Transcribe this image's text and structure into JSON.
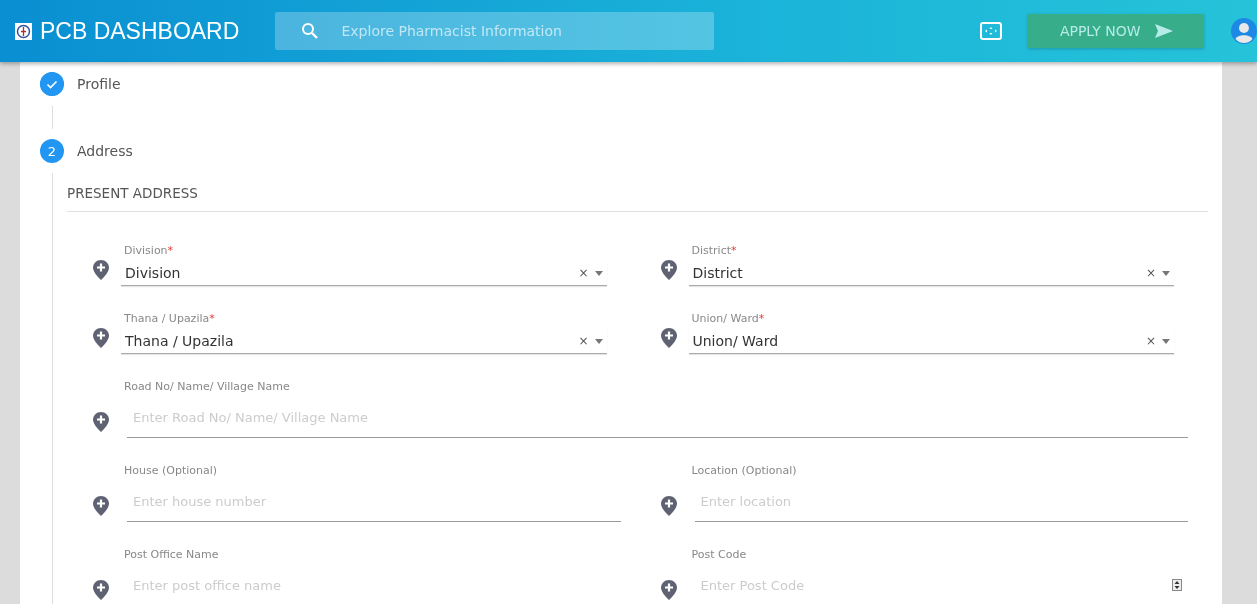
{
  "header": {
    "title": "PCB DASHBOARD",
    "search": {
      "placeholder": "Explore Pharmacist Information"
    },
    "apply_button": "APPLY NOW"
  },
  "steps": [
    {
      "label": "Profile",
      "kind": "done"
    },
    {
      "label": "Address",
      "kind": "active",
      "number": "2"
    }
  ],
  "section": {
    "title": "PRESENT ADDRESS",
    "rows": [
      [
        {
          "kind": "select",
          "label": "Division",
          "required_mark": "*",
          "value": "Division",
          "clear": "×"
        },
        {
          "kind": "select",
          "label": "District",
          "required_mark": "*",
          "value": "District",
          "clear": "×"
        }
      ],
      [
        {
          "kind": "select",
          "label": "Thana / Upazila",
          "required_mark": "*",
          "value": "Thana / Upazila",
          "clear": "×"
        },
        {
          "kind": "select",
          "label": "Union/ Ward",
          "required_mark": "*",
          "value": "Union/ Ward",
          "clear": "×"
        }
      ],
      [
        {
          "kind": "input",
          "label": "Road No/ Name/ Village Name",
          "placeholder": "Enter Road No/ Name/ Village Name"
        }
      ],
      [
        {
          "kind": "input",
          "label": "House (Optional)",
          "placeholder": "Enter house number"
        },
        {
          "kind": "input",
          "label": "Location (Optional)",
          "placeholder": "Enter location"
        }
      ],
      [
        {
          "kind": "input",
          "label": "Post Office Name",
          "placeholder": "Enter post office name"
        },
        {
          "kind": "number",
          "label": "Post Code",
          "placeholder": "Enter Post Code"
        }
      ]
    ]
  }
}
